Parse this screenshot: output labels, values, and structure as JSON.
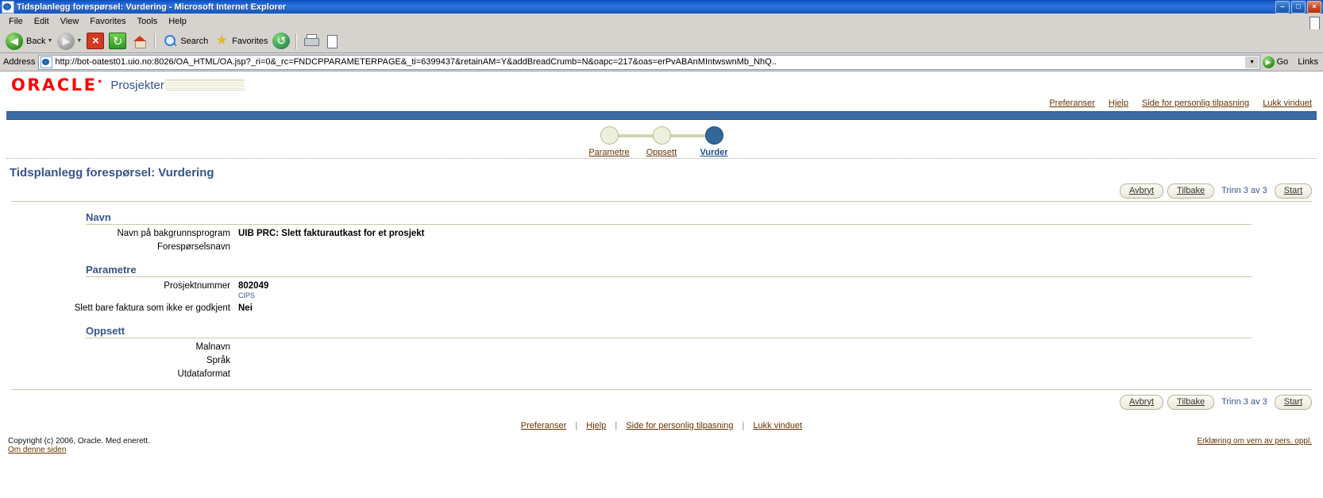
{
  "window": {
    "title": "Tidsplanlegg forespørsel: Vurdering - Microsoft Internet Explorer",
    "minimize": "–",
    "maximize": "□",
    "close": "×"
  },
  "menu": [
    "File",
    "Edit",
    "View",
    "Favorites",
    "Tools",
    "Help"
  ],
  "toolbar": {
    "back": "Back",
    "search": "Search",
    "favorites": "Favorites"
  },
  "address": {
    "label": "Address",
    "url": "http://bot-oatest01.uio.no:8026/OA_HTML/OA.jsp?_ri=0&_rc=FNDCPPARAMETERPAGE&_ti=6399437&retainAM=Y&addBreadCrumb=N&oapc=217&oas=erPvABAnMIntwswnMb_NhQ..",
    "go": "Go",
    "links": "Links"
  },
  "header": {
    "logo": "ORACLE",
    "app_name": "Prosjekter",
    "global_links": [
      "Preferanser",
      "Hjelp",
      "Side for personlig tilpasning",
      "Lukk vinduet"
    ]
  },
  "train": {
    "steps": [
      {
        "label": "Parametre",
        "state": "done"
      },
      {
        "label": "Oppsett",
        "state": "done"
      },
      {
        "label": "Vurder",
        "state": "current"
      }
    ]
  },
  "page": {
    "title": "Tidsplanlegg forespørsel: Vurdering",
    "buttons": {
      "cancel": "Avbryt",
      "back": "Tilbake",
      "step_text": "Trinn 3 av 3",
      "submit": "Start"
    }
  },
  "sections": [
    {
      "heading": "Navn",
      "rows": [
        {
          "label": "Navn på bakgrunnsprogram",
          "value": "UIB PRC: Slett fakturautkast for et prosjekt",
          "sub": ""
        },
        {
          "label": "Forespørselsnavn",
          "value": "",
          "sub": ""
        }
      ]
    },
    {
      "heading": "Parametre",
      "rows": [
        {
          "label": "Prosjektnummer",
          "value": "802049",
          "sub": "CIPS"
        },
        {
          "label": "Slett bare faktura som ikke er godkjent",
          "value": "Nei",
          "sub": ""
        }
      ]
    },
    {
      "heading": "Oppsett",
      "rows": [
        {
          "label": "Malnavn",
          "value": "",
          "sub": ""
        },
        {
          "label": "Språk",
          "value": "",
          "sub": ""
        },
        {
          "label": "Utdataformat",
          "value": "",
          "sub": ""
        }
      ]
    }
  ],
  "footer": {
    "links": [
      "Preferanser",
      "Hjelp",
      "Side for personlig tilpasning",
      "Lukk vinduet"
    ],
    "separator": "|",
    "copyright": "Copyright (c) 2006, Oracle. Med enerett.",
    "about": "Om denne siden",
    "privacy": "Erklæring om vern av pers. oppl."
  }
}
